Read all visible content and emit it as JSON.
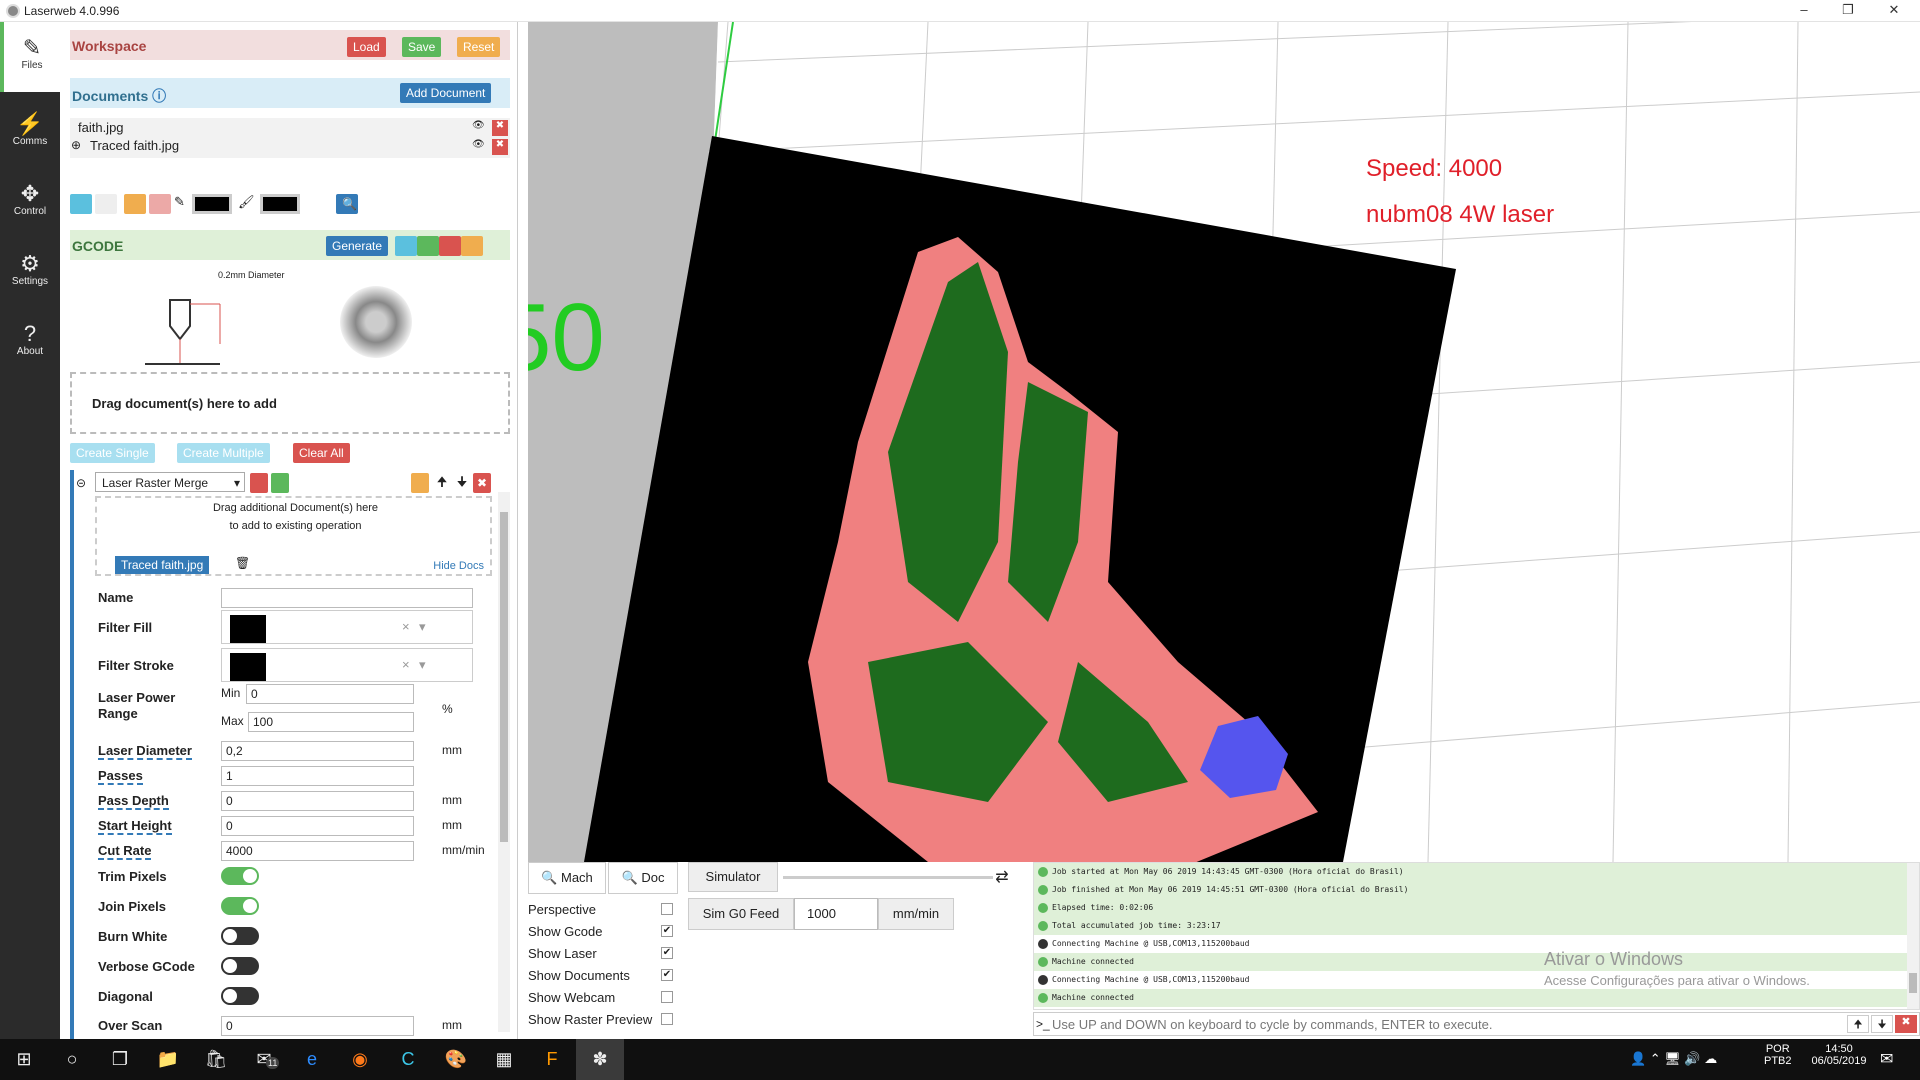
{
  "window": {
    "title": "Laserweb 4.0.996"
  },
  "nav": [
    {
      "label": "Files",
      "icon": "file-edit-icon"
    },
    {
      "label": "Comms",
      "icon": "plug-icon"
    },
    {
      "label": "Control",
      "icon": "arrows-icon"
    },
    {
      "label": "Settings",
      "icon": "gears-icon"
    },
    {
      "label": "About",
      "icon": "question-icon"
    }
  ],
  "workspace": {
    "title": "Workspace",
    "load": "Load",
    "save": "Save",
    "reset": "Reset"
  },
  "documents": {
    "title": "Documents",
    "add": "Add Document",
    "items": [
      "faith.jpg",
      "Traced faith.jpg"
    ]
  },
  "gcode": {
    "title": "GCODE",
    "generate": "Generate",
    "diameter_note": "0.2mm Diameter"
  },
  "dropzone": "Drag document(s) here to add",
  "create": {
    "single": "Create Single",
    "multiple": "Create Multiple",
    "clear": "Clear All"
  },
  "operation": {
    "type": "Laser Raster Merge",
    "drag_line1": "Drag additional Document(s) here",
    "drag_line2": "to add to existing operation",
    "doc": "Traced faith.jpg",
    "hide_docs": "Hide Docs"
  },
  "fields": {
    "name": {
      "label": "Name",
      "value": ""
    },
    "filter_fill": "Filter Fill",
    "filter_stroke": "Filter Stroke",
    "power_label_1": "Laser Power",
    "power_label_2": "Range",
    "min_label": "Min",
    "max_label": "Max",
    "min": "0",
    "max": "100",
    "pct": "%",
    "diameter": {
      "label": "Laser Diameter",
      "value": "0,2",
      "unit": "mm"
    },
    "passes": {
      "label": "Passes",
      "value": "1"
    },
    "depth": {
      "label": "Pass Depth",
      "value": "0",
      "unit": "mm"
    },
    "start": {
      "label": "Start Height",
      "value": "0",
      "unit": "mm"
    },
    "cut": {
      "label": "Cut Rate",
      "value": "4000",
      "unit": "mm/min"
    },
    "trim": "Trim Pixels",
    "join": "Join Pixels",
    "burn": "Burn White",
    "verbose": "Verbose GCode",
    "diagonal": "Diagonal",
    "overscan": {
      "label": "Over Scan",
      "value": "0",
      "unit": "mm"
    }
  },
  "toggles": {
    "trim": true,
    "join": true,
    "burn": false,
    "verbose": false,
    "diagonal": false
  },
  "viewport": {
    "annot1": "Speed: 4000",
    "annot2": "nubm08 4W laser",
    "grid_label": "50",
    "annot_color": "#e0202a"
  },
  "view": {
    "mach": "Mach",
    "doc": "Doc",
    "simulator": "Simulator",
    "sim_feed": "Sim G0 Feed",
    "sim_value": "1000",
    "sim_unit": "mm/min"
  },
  "options": [
    {
      "label": "Perspective",
      "checked": false
    },
    {
      "label": "Show Gcode",
      "checked": true
    },
    {
      "label": "Show Laser",
      "checked": true
    },
    {
      "label": "Show Documents",
      "checked": true
    },
    {
      "label": "Show Webcam",
      "checked": false
    },
    {
      "label": "Show Raster Preview",
      "checked": false
    }
  ],
  "log": [
    {
      "text": "Job started at Mon May 06 2019 14:43:45 GMT-0300 (Hora oficial do Brasil)",
      "kind": "ok"
    },
    {
      "text": "Job finished at Mon May 06 2019 14:45:51 GMT-0300 (Hora oficial do Brasil)",
      "kind": "ok"
    },
    {
      "text": "Elapsed time: 0:02:06",
      "kind": "ok"
    },
    {
      "text": "Total accumulated job time: 3:23:17",
      "kind": "ok"
    },
    {
      "text": "Connecting Machine @ USB,COM13,115200baud",
      "kind": "info"
    },
    {
      "text": "Machine connected",
      "kind": "ok"
    },
    {
      "text": "Connecting Machine @ USB,COM13,115200baud",
      "kind": "info"
    },
    {
      "text": "Machine connected",
      "kind": "ok"
    }
  ],
  "console": {
    "placeholder": "Use UP and DOWN on keyboard to cycle by commands, ENTER to execute."
  },
  "watermark": {
    "line1": "Ativar o Windows",
    "line2": "Acesse Configurações para ativar o Windows."
  },
  "taskbar": {
    "lang1": "POR",
    "lang2": "PTB2",
    "time": "14:50",
    "date": "06/05/2019",
    "mail_badge": "11"
  }
}
